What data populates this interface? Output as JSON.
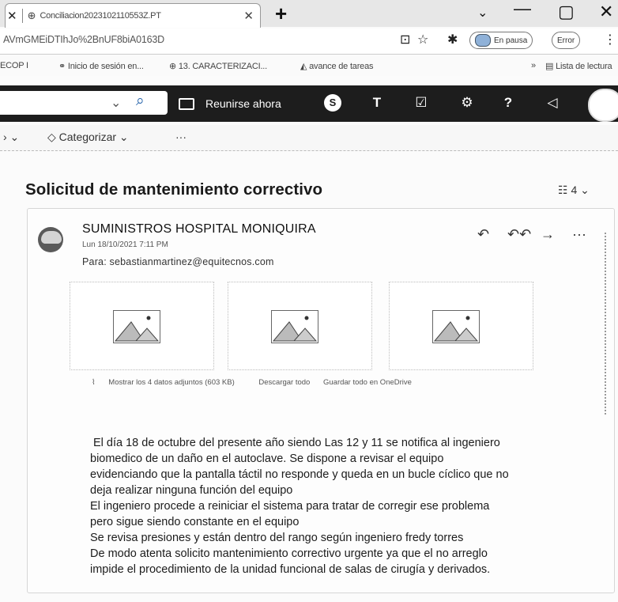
{
  "browser": {
    "tab_title": "Conciliacion2023102110553Z.PT",
    "new_tab": "+",
    "url": "AVmGMEiDTIhJo%2BnUF8biA0163D",
    "profile_status": "En pausa",
    "error_label": "Error"
  },
  "bookmarks": {
    "items": [
      {
        "label": "ECOP I"
      },
      {
        "label": "Inicio de sesión en..."
      },
      {
        "label": "13. CARACTERIZACI..."
      },
      {
        "label": "avance de tareas"
      },
      {
        "label": "Lista de lectura"
      }
    ]
  },
  "outlook": {
    "meet_now": "Reunirse ahora"
  },
  "toolbar": {
    "categorize": "Categorizar"
  },
  "message": {
    "subject": "Solicitud de mantenimiento correctivo",
    "count": "4",
    "sender": "SUMINISTROS HOSPITAL MONIQUIRA",
    "date": "Lun 18/10/2021 7:11 PM",
    "to_line": "Para:  sebastianmartinez@equitecnos.com",
    "attachments_summary": "Mostrar los 4 datos adjuntos (603 KB)",
    "download_all": "Descargar todo",
    "save_onedrive": "Guardar todo en OneDrive",
    "body": [
      "El día 18 de octubre del presente año siendo Las 12 y 11 se notifica al ingeniero",
      "biomedico de un daño en el autoclave. Se dispone a revisar  el equipo",
      "evidenciando que la pantalla táctil no responde y queda en un bucle cíclico que no",
      "deja realizar ninguna función del equipo",
      "El ingeniero procede a reiniciar el sistema para tratar de corregir ese problema",
      "pero sigue siendo constante en el equipo",
      "Se revisa presiones y están dentro del rango según ingeniero fredy torres",
      "De modo atenta solicito mantenimiento correctivo urgente ya que el no arreglo",
      "impide el procedimiento de la unidad funcional de salas de cirugía y derivados."
    ]
  },
  "icons": {
    "reply": "reply-icon",
    "reply_all": "reply-all-icon",
    "forward": "forward-icon",
    "more": "more-icon"
  }
}
